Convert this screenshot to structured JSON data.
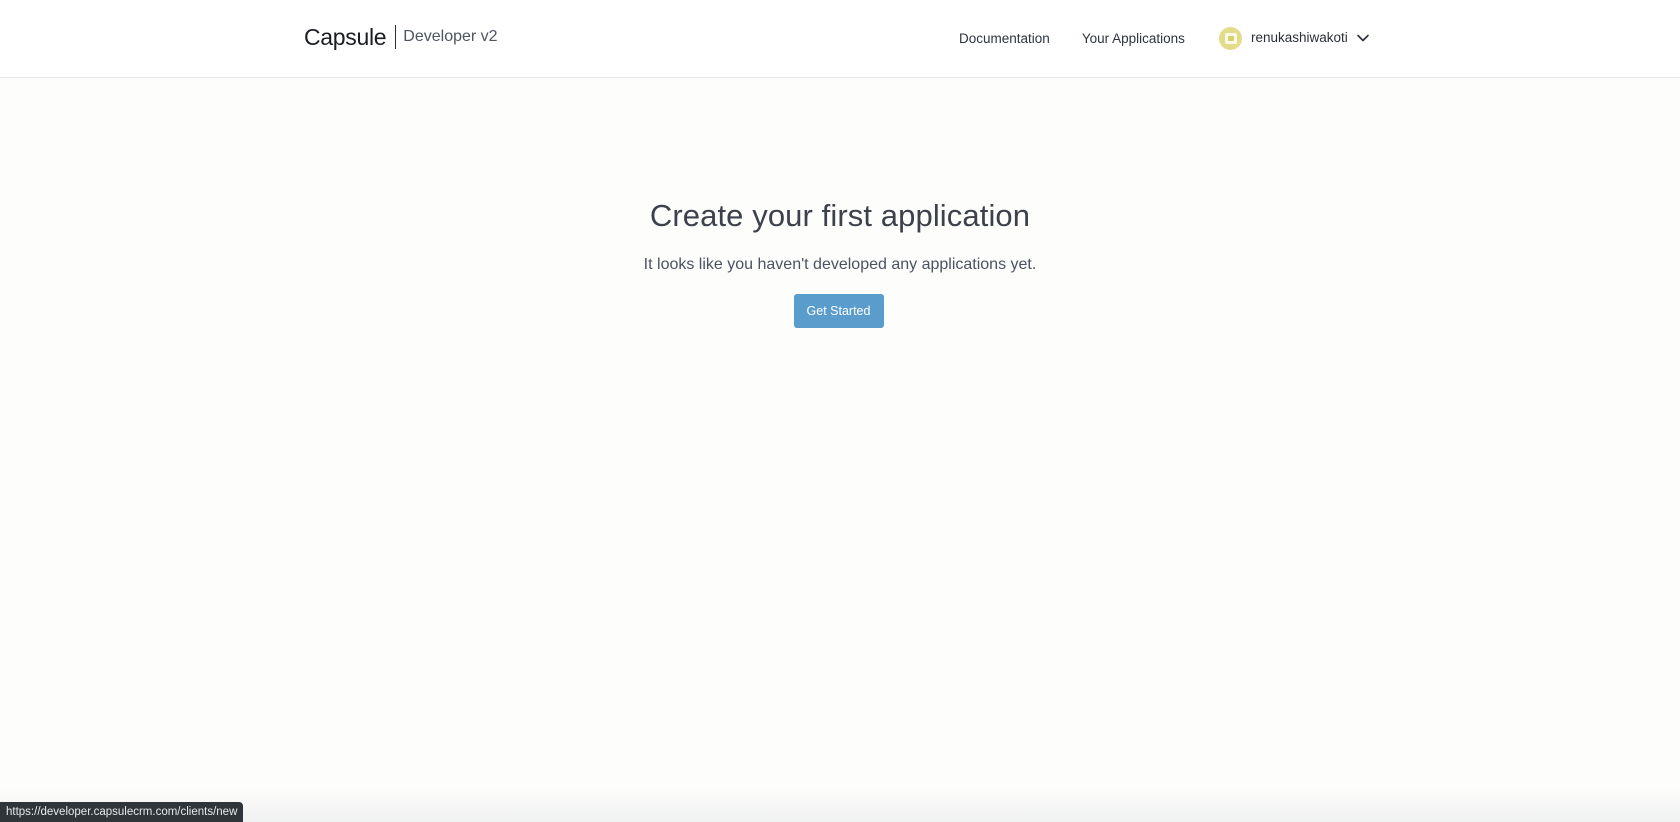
{
  "header": {
    "brand_logo": "Capsule",
    "brand_subtitle": "Developer v2",
    "nav": {
      "documentation": "Documentation",
      "your_applications": "Your Applications"
    },
    "user": {
      "username": "renukashiwakoti"
    }
  },
  "main": {
    "title": "Create your first application",
    "subtitle": "It looks like you haven't developed any applications yet.",
    "cta_label": "Get Started"
  },
  "status_bar": {
    "url": "https://developer.capsulecrm.com/clients/new"
  },
  "colors": {
    "button": "#5a9ccc",
    "avatar": "#e4dc8b",
    "status_bar": "#30353a"
  },
  "icons": {
    "user_menu": "chevron-down-icon",
    "avatar": "avatar-icon"
  }
}
